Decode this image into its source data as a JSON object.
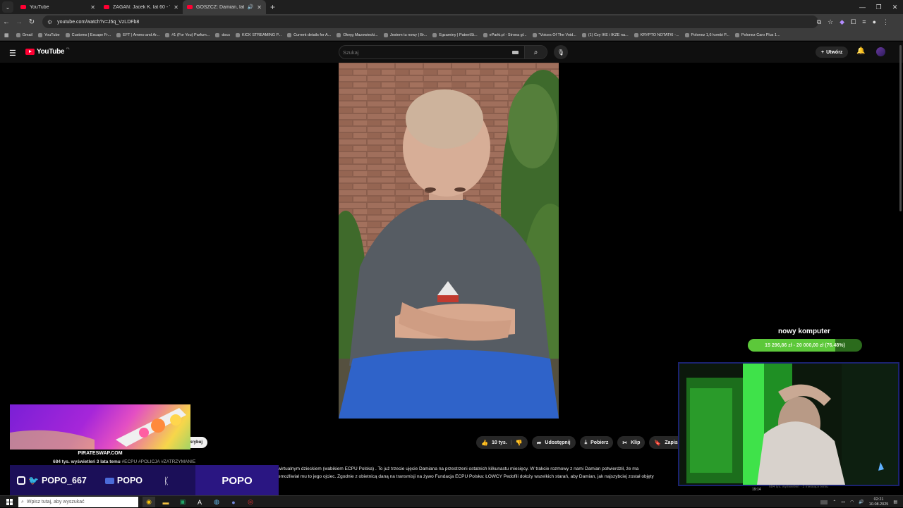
{
  "browser": {
    "tabs": [
      {
        "label": "YouTube",
        "active": false
      },
      {
        "label": "ŻAGAŃ: Jacek K. lat 60 - YouTube",
        "active": false
      },
      {
        "label": "GOSZCZ: Damian, lat 26 - YouTube",
        "active": true
      }
    ],
    "url": "youtube.com/watch?v=J5q_VzLDFb8",
    "bookmarks": [
      "Gmail",
      "YouTube",
      "Customs | Escape Fr...",
      "EFT | Ammo and Ar...",
      "#1 (For You) Parfum...",
      "docs",
      "KICK STREAMING P...",
      "Current details for A...",
      "Okręg Mazowiecki...",
      "Jestem tu nowy | Br...",
      "Egzaminy | PatentSt...",
      "eParki.pl - Strona gł...",
      "\"Voices Of The Void...",
      "(1) Czy IKE i IKZE na...",
      "KRYPTO NOTATKI -...",
      "Polonez 1,6 kombi P...",
      "Polonez Caro Plus 1..."
    ]
  },
  "youtube": {
    "logo": "YouTube",
    "region": "PL",
    "search_placeholder": "Szukaj",
    "create_label": "Utwórz",
    "actions": {
      "likes": "10 tys.",
      "share": "Udostępnij",
      "download": "Pobierz",
      "clip": "Klip",
      "save": "Zapisz"
    },
    "subscribe_partial": "krybuj",
    "meta_stats": "684 tys. wyświetleń  3 lata temu",
    "meta_tags": "#ECPU #POLICJA #ZATRZYMANIE",
    "description_line1": "wirtualnym dzieckiem (wabikiem ECPU Polska) . To już trzecie ujęcie Damiana na przestrzeni ostatnich kilkunastu miesięcy. W trakcie rozmowy z nami Damian potwierdził, że ma",
    "description_line2": "emożliwiał mu to jego ojciec. Zgodnie z obietnicą daną na transmisji na żywo Fundacja ECPU Polska: ŁOWCY Pedofili dołoży wszelkich starań, aby Damian, jak najszybciej został objęty"
  },
  "overlay": {
    "promo_site": "PIRATESWAP.COM",
    "instagram_handle": "POPO_667",
    "youtube_handle": "POPO",
    "kick_handle": "POPO",
    "goal_title": "nowy komputer",
    "goal_text": "15 296,86 zł - 20 000,00 zł (76.48%)",
    "goal_progress": 0.7648,
    "cam_time": "19:14",
    "cam_ghost_text": "684 tys. wyświetleń · 3 miesiące temu"
  },
  "taskbar": {
    "search_placeholder": "Wpisz tutaj, aby wyszukać",
    "time": "02:21",
    "date": "10.08.2025"
  },
  "colors": {
    "yt_red": "#ff0033",
    "goal_green": "#5cc83a",
    "social_bg": "#1b0f58"
  }
}
